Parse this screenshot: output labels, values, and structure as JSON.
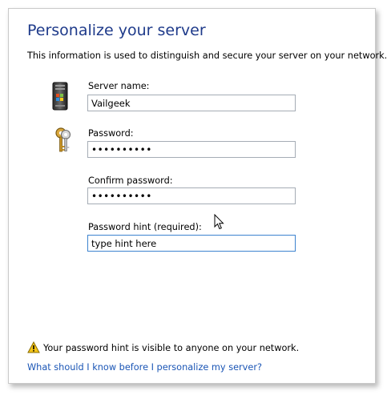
{
  "page": {
    "title": "Personalize your server",
    "description": "This information is used to distinguish and secure your server on your network."
  },
  "fields": {
    "server_name": {
      "label": "Server name:",
      "value": "Vailgeek"
    },
    "password": {
      "label": "Password:",
      "value": "••••••••••"
    },
    "confirm_password": {
      "label": "Confirm password:",
      "value": "••••••••••"
    },
    "password_hint": {
      "label": "Password hint (required):",
      "value": "type hint here"
    }
  },
  "icons": {
    "server": "server-icon",
    "keys": "keys-icon",
    "warning": "warning-icon",
    "cursor": "mouse-cursor-icon"
  },
  "footer": {
    "warning_text": "Your password hint is visible to anyone on your network.",
    "help_link": "What should I know before I personalize my server?"
  },
  "colors": {
    "title": "#1e3a8a",
    "link": "#1a55b5",
    "focus_border": "#3d83cf"
  }
}
